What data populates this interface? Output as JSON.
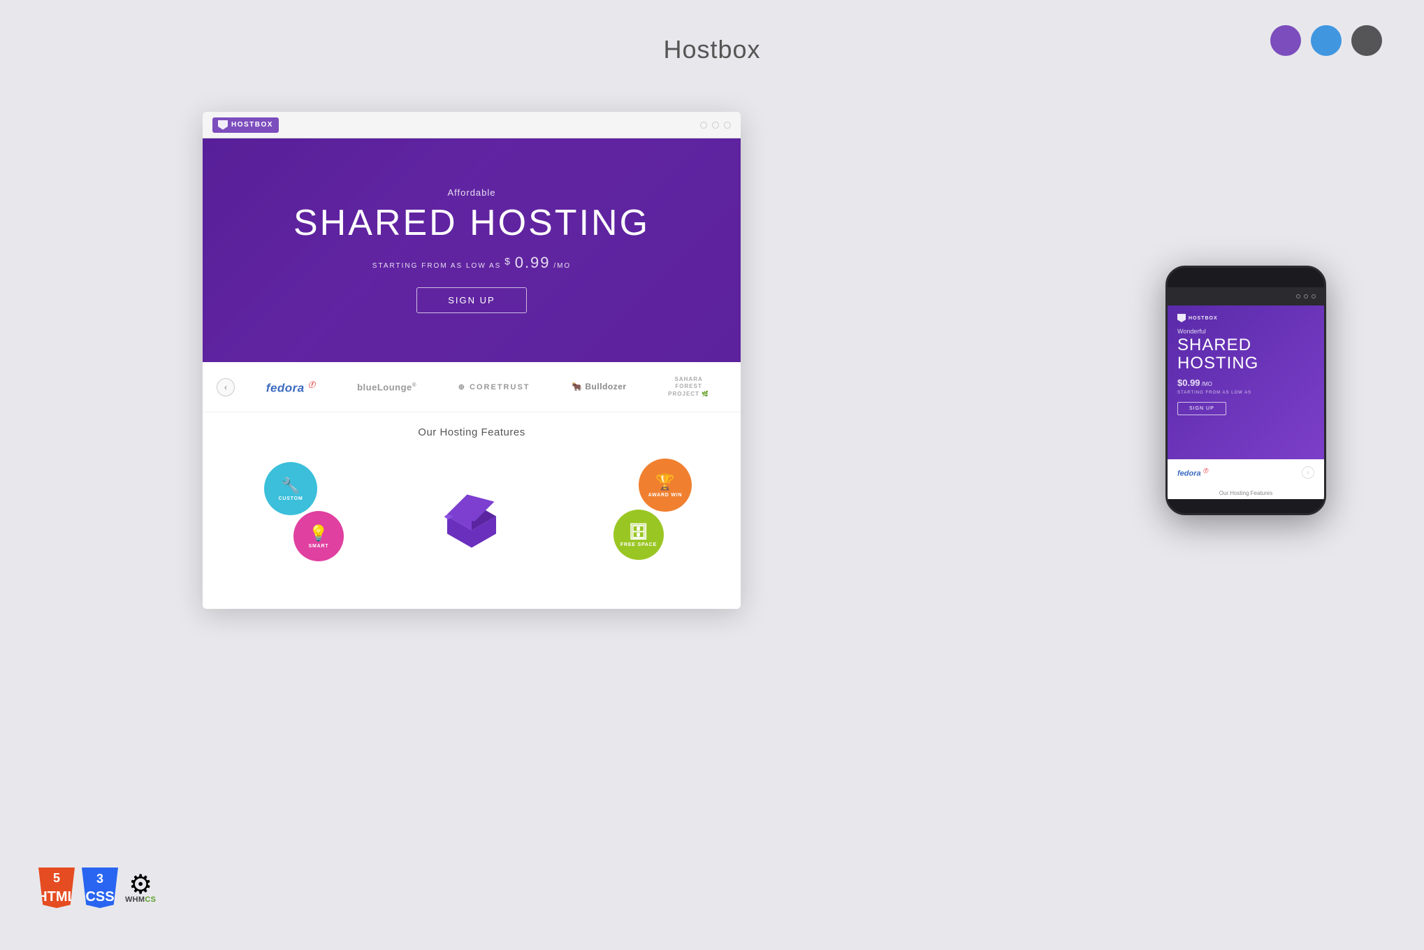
{
  "page": {
    "title": "Hostbox",
    "bg_color": "#e8e8ec"
  },
  "color_theme": {
    "dots": [
      {
        "color": "#7c4dbd",
        "label": "purple"
      },
      {
        "color": "#4196e0",
        "label": "blue"
      },
      {
        "color": "#555557",
        "label": "dark"
      }
    ]
  },
  "browser": {
    "logo": "HOSTBOX",
    "dots": [
      "○",
      "○",
      "○"
    ]
  },
  "hero": {
    "affordable": "Affordable",
    "title": "SHARED HOSTING",
    "price_prefix": "STARTING FROM AS LOW AS",
    "price_dollar": "$",
    "price_amount": "0.99",
    "price_suffix": "/MO",
    "signup_button": "SIGN UP"
  },
  "logos": {
    "prev_arrow": "‹",
    "items": [
      {
        "label": "fedora",
        "class": "fedora"
      },
      {
        "label": "blueLounge®",
        "class": "blue"
      },
      {
        "label": "CORETRUST",
        "class": "core"
      },
      {
        "label": "Bulldozer",
        "class": "bull"
      },
      {
        "label": "SAHARA FOREST PROJECT",
        "class": "sahara"
      }
    ]
  },
  "features": {
    "title": "Our Hosting Features",
    "circles": [
      {
        "label": "CUSTOM",
        "color": "#3bbfdb",
        "icon": "🔧"
      },
      {
        "label": "SMART",
        "color": "#e040a0",
        "icon": "💡"
      },
      {
        "label": "AWARD WIN",
        "color": "#f08030",
        "icon": "🏆"
      },
      {
        "label": "FREE SPACE",
        "color": "#9ac624",
        "icon": "🗄"
      }
    ]
  },
  "phone": {
    "logo": "HOSTBOX",
    "wonderful": "Wonderful",
    "title_line1": "SHARED",
    "title_line2": "HOSTING",
    "price_prefix": "$",
    "price_amount": "0.99",
    "price_suffix": "/MO",
    "starting": "STARTING FROM AS LOW AS",
    "signup_button": "SIGN UP",
    "logo_item": "fedora",
    "features_title": "Our Hosting Features"
  },
  "tech_badges": {
    "html5": "5",
    "css3": "3",
    "whmcs_label": "WHM",
    "whmcs_suffix": "CS"
  }
}
